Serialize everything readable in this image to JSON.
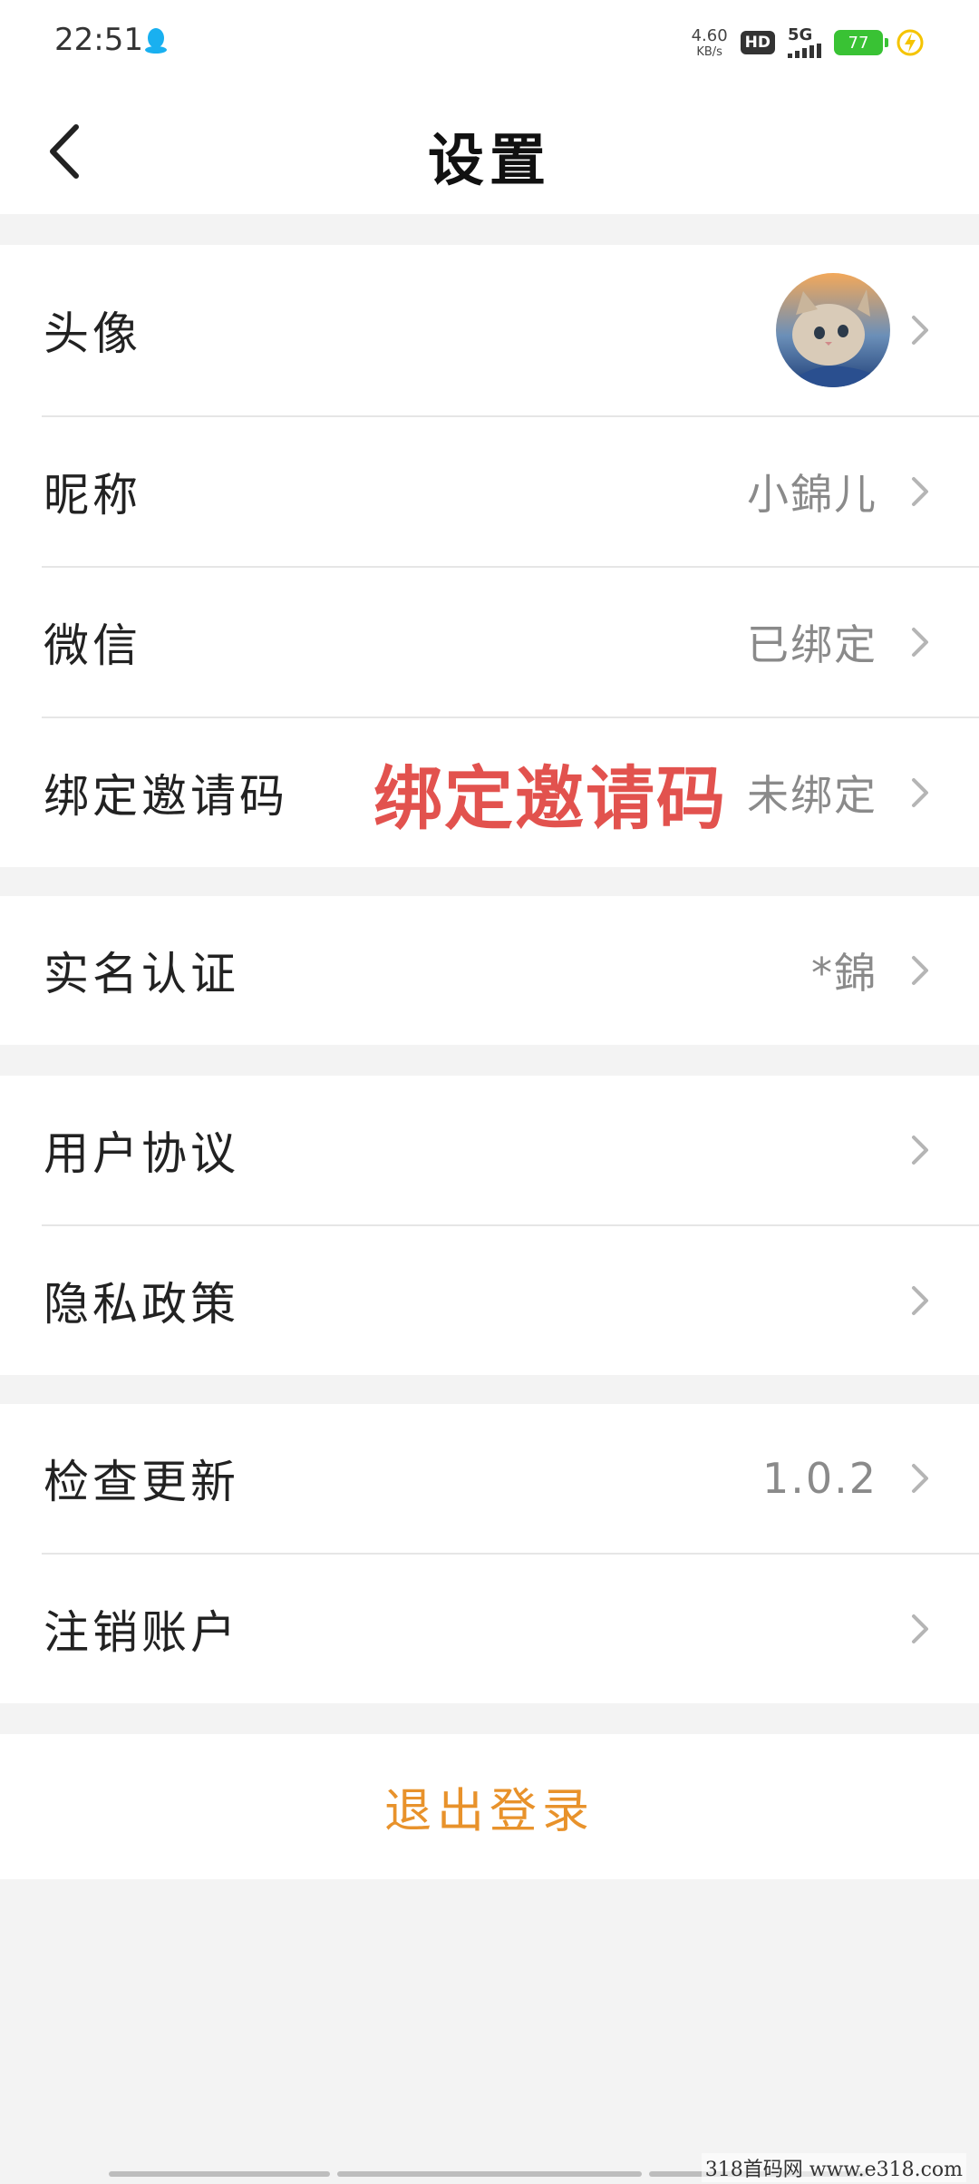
{
  "status_bar": {
    "time": "22:51",
    "net_speed_value": "4.60",
    "net_speed_unit": "KB/s",
    "hd_badge": "HD",
    "signal_label": "5G",
    "battery_level": "77",
    "battery_color": "#39c234",
    "charge_icon_color": "#f5c400"
  },
  "header": {
    "title": "设置",
    "back_icon": "chevron-left-icon"
  },
  "rows": {
    "avatar": {
      "label": "头像"
    },
    "nickname": {
      "label": "昵称",
      "value": "小錦儿"
    },
    "wechat": {
      "label": "微信",
      "value": "已绑定"
    },
    "invite": {
      "label": "绑定邀请码",
      "value": "未绑定",
      "overlay": "绑定邀请码"
    },
    "realname": {
      "label": "实名认证",
      "value": "*錦"
    },
    "agreement": {
      "label": "用户协议"
    },
    "privacy": {
      "label": "隐私政策"
    },
    "update": {
      "label": "检查更新",
      "value": "1.0.2"
    },
    "deregister": {
      "label": "注销账户"
    }
  },
  "logout": {
    "label": "退出登录"
  },
  "watermark": "318首码网  www.e318.com",
  "colors": {
    "accent_logout": "#e8922b",
    "overlay_red": "#e0443f",
    "page_bg": "#f3f3f3"
  }
}
